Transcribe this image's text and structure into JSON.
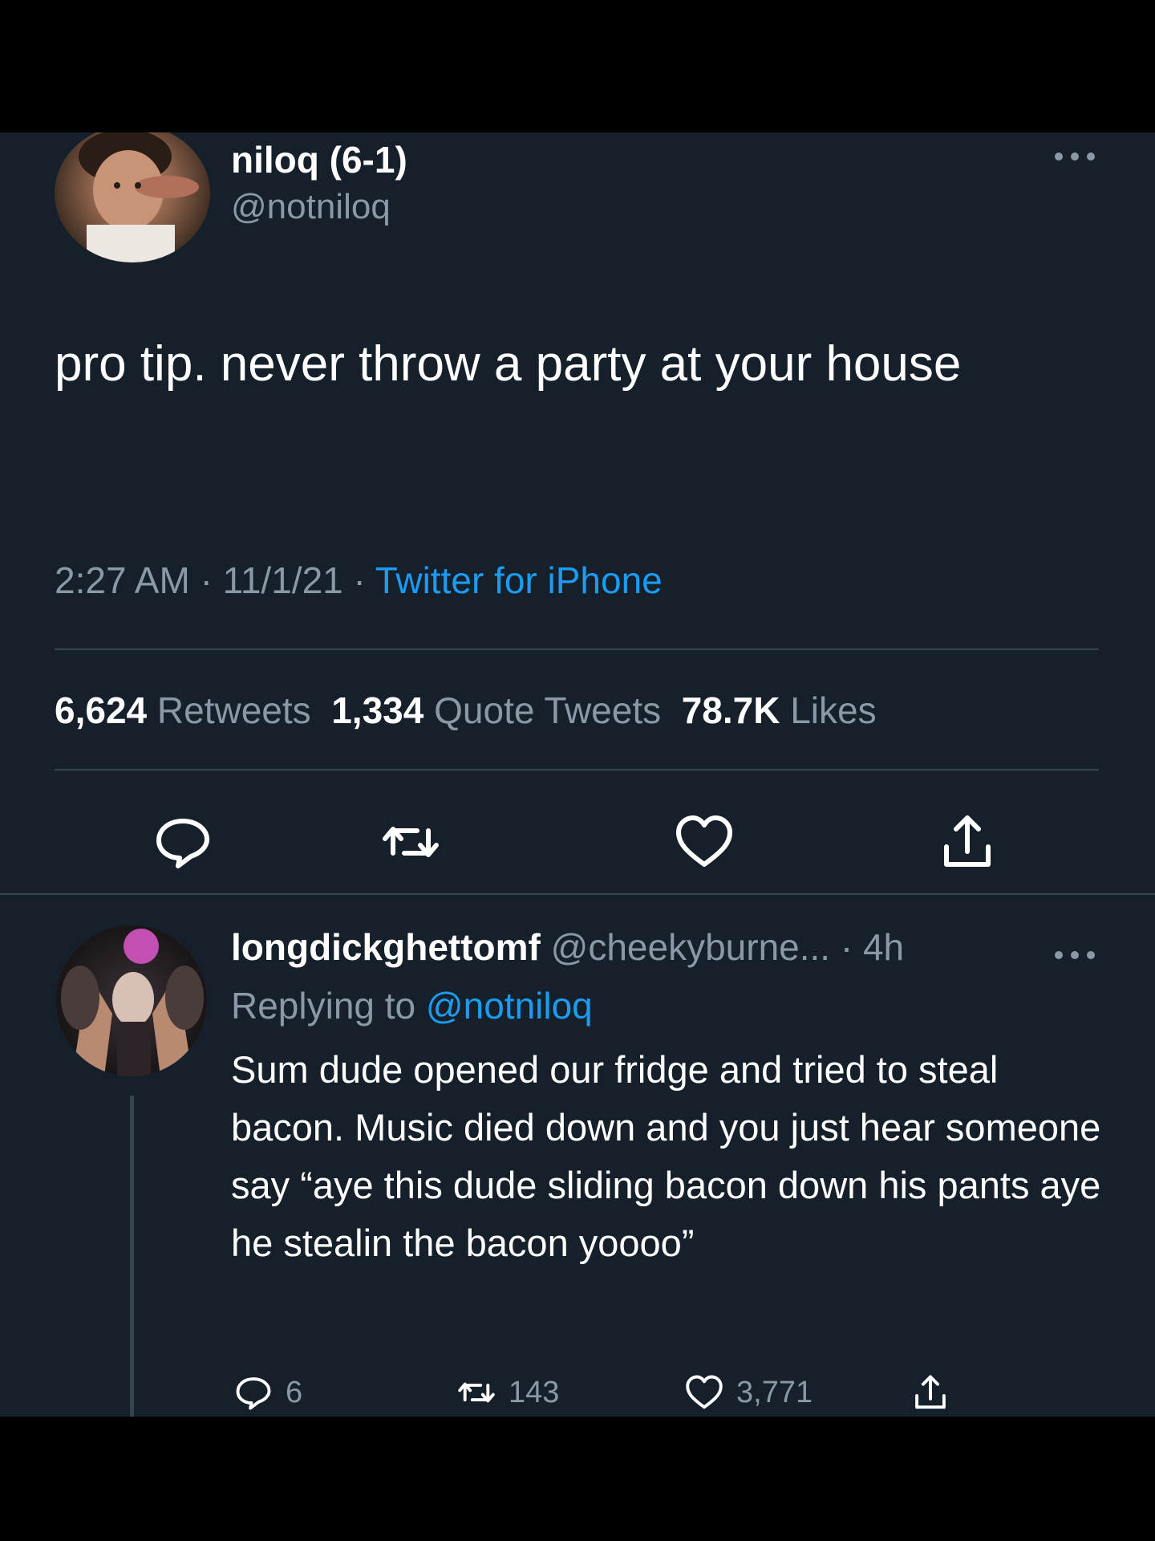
{
  "colors": {
    "background": "#15202b",
    "text_primary": "#ffffff",
    "text_secondary": "#8b98a5",
    "link": "#1d9bf0",
    "divider": "#38444d"
  },
  "main_tweet": {
    "display_name": "niloq (6-1)",
    "handle": "@notniloq",
    "text": "pro tip. never throw a party at your house",
    "time": "2:27 AM",
    "date": "11/1/21",
    "source": "Twitter for iPhone",
    "separator": "·",
    "stats": {
      "retweets_count": "6,624",
      "retweets_label": "Retweets",
      "quotes_count": "1,334",
      "quotes_label": "Quote Tweets",
      "likes_count": "78.7K",
      "likes_label": "Likes"
    },
    "actions": [
      "reply-icon",
      "retweet-icon",
      "like-icon",
      "share-icon"
    ],
    "more_icon": "more-options-icon"
  },
  "reply": {
    "display_name": "longdickghettomf",
    "handle": "@cheekyburne...",
    "age": "4h",
    "separator": "·",
    "replying_prefix": "Replying to",
    "replying_to": "@notniloq",
    "text": "Sum dude opened our fridge and tried to steal bacon. Music died down and you just hear someone say “aye this dude sliding bacon down his pants aye he stealin the bacon yoooo”",
    "counts": {
      "replies": "6",
      "retweets": "143",
      "likes": "3,771"
    },
    "more_icon": "more-options-icon"
  }
}
